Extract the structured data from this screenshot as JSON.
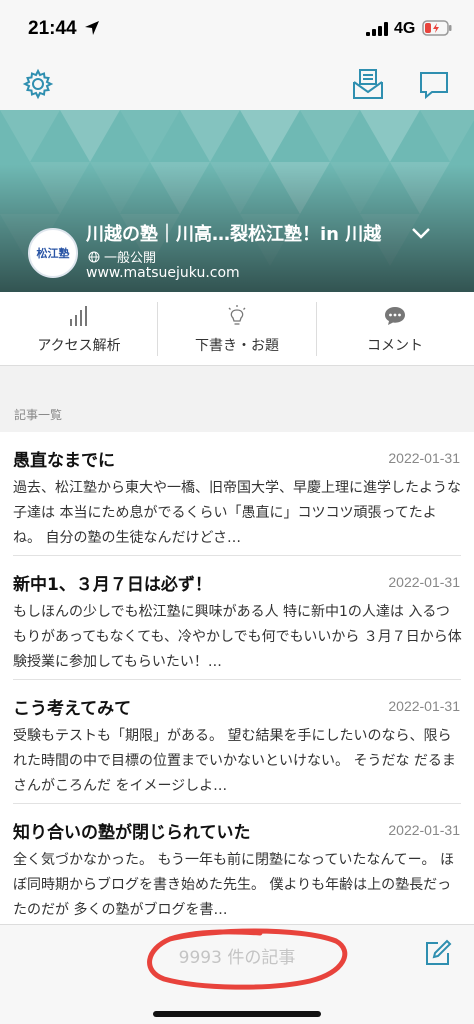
{
  "status": {
    "time": "21:44",
    "network": "4G"
  },
  "toolbar": {
    "settings_icon": "gear-icon",
    "mail_icon": "mail-icon",
    "message_icon": "chat-bubble-icon"
  },
  "blog": {
    "avatar_text": "松江塾",
    "title": "川越の塾｜川高…裂松江塾！in 川越",
    "visibility": "一般公開",
    "url": "www.matsuejuku.com",
    "banner_color": "#6fb9b4"
  },
  "actions": [
    {
      "label": "アクセス解析",
      "icon": "bar-chart-icon"
    },
    {
      "label": "下書き・お題",
      "icon": "lightbulb-icon"
    },
    {
      "label": "コメント",
      "icon": "comment-icon"
    }
  ],
  "list_section": {
    "label": "記事一覧"
  },
  "articles": [
    {
      "title": "愚直なまでに",
      "date": "2022-01-31",
      "excerpt": "過去、松江塾から東大や一橋、旧帝国大学、早慶上理に進学したような子達は 本当にため息がでるくらい「愚直に」コツコツ頑張ってたよね。 自分の塾の生徒なんだけどさ…"
    },
    {
      "title": "新中1、３月７日は必ず！",
      "date": "2022-01-31",
      "excerpt": "もしほんの少しでも松江塾に興味がある人 特に新中1の人達は 入るつもりがあってもなくても、冷やかしでも何でもいいから ３月７日から体験授業に参加してもらいたい！…"
    },
    {
      "title": "こう考えてみて",
      "date": "2022-01-31",
      "excerpt": "受験もテストも「期限」がある。 望む結果を手にしたいのなら、限られた時間の中で目標の位置までいかないといけない。 そうだな だるまさんがころんだ をイメージしよ…"
    },
    {
      "title": "知り合いの塾が閉じられていた",
      "date": "2022-01-31",
      "excerpt": "全く気づかなかった。 もう一年も前に閉塾になっていたなんてー。 ほぼ同時期からブログを書き始めた先生。 僕よりも年齢は上の塾長だったのだが 多くの塾がブログを書…"
    }
  ],
  "footer": {
    "count_label": "9993 件の記事",
    "compose_icon": "compose-icon"
  },
  "colors": {
    "accent": "#2f8fb0",
    "annotation": "#e8433c"
  }
}
